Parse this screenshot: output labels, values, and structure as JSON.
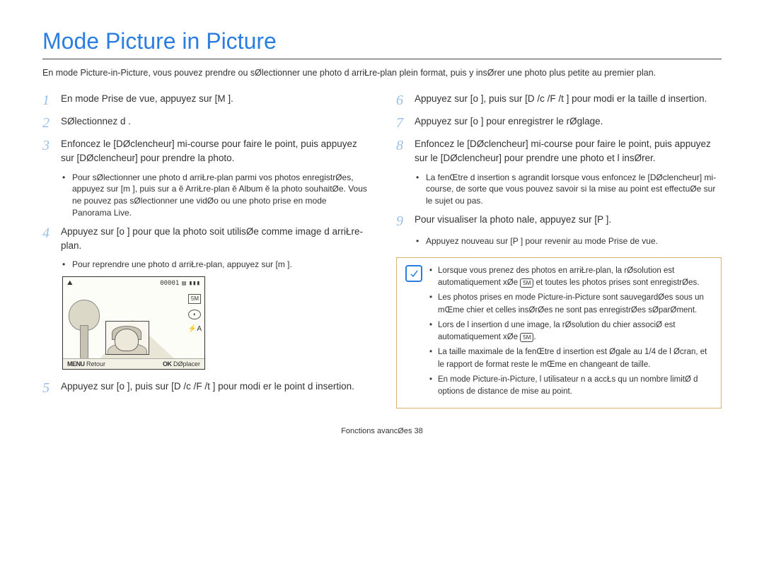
{
  "title": "Mode Picture in Picture",
  "intro": "En mode Picture-in-Picture, vous pouvez prendre ou sØlectionner une photo d arriŁre-plan plein format, puis y insØrer une photo plus petite au premier plan.",
  "left": {
    "s1": "En mode Prise de vue, appuyez sur [M    ].",
    "s2": "SØlectionnez d   .",
    "s3": "Enfoncez le [DØclencheur]   mi-course pour faire le point, puis appuyez sur [DØclencheur] pour prendre la photo.",
    "s3_note": "Pour sØlectionner une photo d arriŁre-plan parmi vos photos enregistrØes, appuyez sur [m    ], puis sur a   ĕ ArriŁre-plan ĕ Album ĕ la photo souhaitØe. Vous ne pouvez pas sØlectionner une vidØo ou une photo prise en mode Panorama Live.",
    "s4": "Appuyez sur [o   ] pour que la photo soit utilisØe comme image d arriŁre-plan.",
    "s4_note": "Pour reprendre une photo d arriŁre-plan, appuyez sur [m   ].",
    "s5": "Appuyez sur [o   ], puis sur [D    /c   /F /t    ] pour modi er le point d insertion."
  },
  "lcd": {
    "counter": "00001",
    "menu_label": "Retour",
    "ok_label": "DØplacer",
    "icon_5m": "5M",
    "flash_auto": "⚡A"
  },
  "right": {
    "s6": "Appuyez sur [o   ], puis sur [D    /c   /F /t    ] pour modi er la taille d insertion.",
    "s7": "Appuyez sur [o   ] pour enregistrer le rØglage.",
    "s8": "Enfoncez le [DØclencheur]   mi-course pour faire le point, puis appuyez sur le [DØclencheur] pour prendre une photo et l insØrer.",
    "s8_note": "La fenŒtre d insertion s agrandit lorsque vous enfoncez le [DØclencheur]   mi-course, de sorte que vous pouvez savoir si la mise au point est effectuØe sur le sujet ou pas.",
    "s9": "Pour visualiser la photo  nale, appuyez sur [P   ].",
    "s9_note": "Appuyez   nouveau sur [P   ] pour revenir au mode Prise de vue."
  },
  "info": {
    "i1a": "Lorsque vous prenez des photos en arriŁre-plan, la rØsolution est automatiquement  xØe ",
    "i1b": " et toutes les photos prises sont enregistrØes.",
    "i2": "Les photos prises en mode Picture-in-Picture sont sauvegardØes sous un mŒme  chier et celles insØrØes ne sont pas enregistrØes sØparØment.",
    "i3a": "Lors de l insertion d une image, la rØsolution du  chier associØ est automatiquement  xØe ",
    "i3b": ".",
    "i4": "La taille maximale de la fenŒtre d insertion est Øgale au 1/4 de l Øcran, et le rapport de format reste le mŒme en changeant de taille.",
    "i5": "En mode Picture-in-Picture, l utilisateur n a accŁs qu   un nombre limitØ d options de distance de mise au point.",
    "res_icon": "5M"
  },
  "footer": "Fonctions avancØes 38"
}
